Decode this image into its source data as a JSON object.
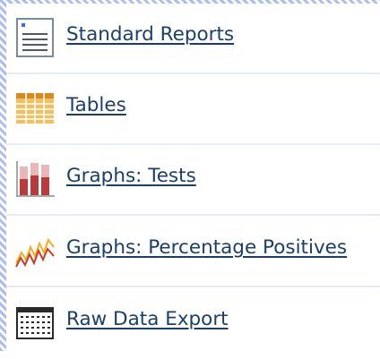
{
  "menu": {
    "items": [
      {
        "label": "Standard Reports",
        "icon": "report-document-icon"
      },
      {
        "label": "Tables",
        "icon": "table-grid-icon"
      },
      {
        "label": "Graphs: Tests",
        "icon": "bar-chart-icon"
      },
      {
        "label": "Graphs: Percentage Positives",
        "icon": "line-chart-icon"
      },
      {
        "label": "Raw Data Export",
        "icon": "data-export-grid-icon"
      }
    ]
  },
  "colors": {
    "link": "#1a3f6b",
    "border_stripe": "#a9bdf0",
    "row_divider": "#e4ecf8",
    "table_icon": "#e0a040",
    "bar_icon": "#b83a3a",
    "line_icon_red": "#d03a2a",
    "line_icon_yellow": "#f0b020"
  }
}
